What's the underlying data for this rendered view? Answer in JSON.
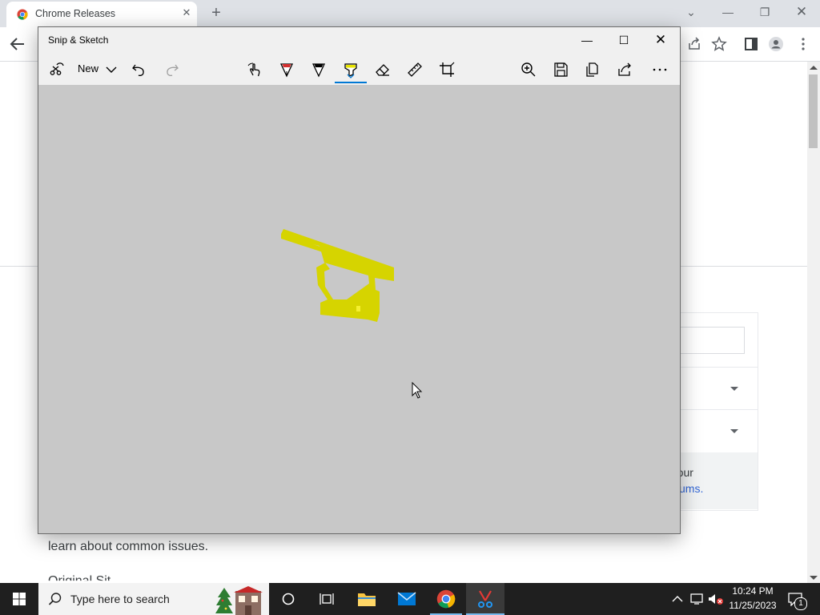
{
  "browser": {
    "tab_title": "Chrome Releases",
    "new_tab_label": "+",
    "page_text": {
      "side_line1": "k in our",
      "side_line2": "ums.",
      "body_line1": "learn about common issues.",
      "body_line2": "Original Sit..."
    }
  },
  "snip": {
    "title": "Snip & Sketch",
    "new_label": "New",
    "active_tool": "highlighter",
    "highlight_color": "#d8d400"
  },
  "taskbar": {
    "search_placeholder": "Type here to search",
    "time": "10:24 PM",
    "date": "11/25/2023",
    "notification_count": "1"
  }
}
